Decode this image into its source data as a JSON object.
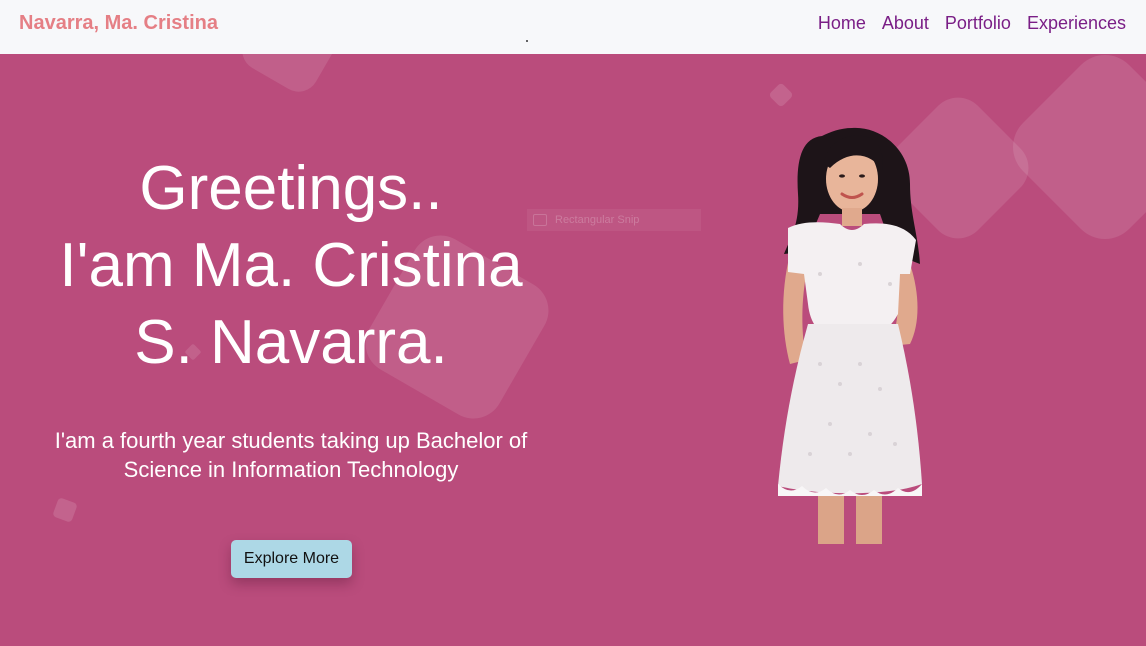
{
  "nav": {
    "brand": "Navarra, Ma. Cristina",
    "links": [
      "Home",
      "About",
      "Portfolio",
      "Experiences"
    ]
  },
  "hero": {
    "headline_lines": [
      "Greetings..",
      "I'am Ma. Cristina",
      "S. Navarra."
    ],
    "subtext_lines": [
      "I'am a fourth year students taking up Bachelor of",
      "Science in Information Technology"
    ],
    "cta_label": "Explore More",
    "ghost_overlay_text": "Rectangular Snip"
  },
  "colors": {
    "hero_background": "#ba4c7c",
    "navbar_background": "#f7f8fa",
    "brand_color": "#e57f85",
    "nav_link_color": "#7a1e86",
    "button_background": "#add8e6"
  }
}
